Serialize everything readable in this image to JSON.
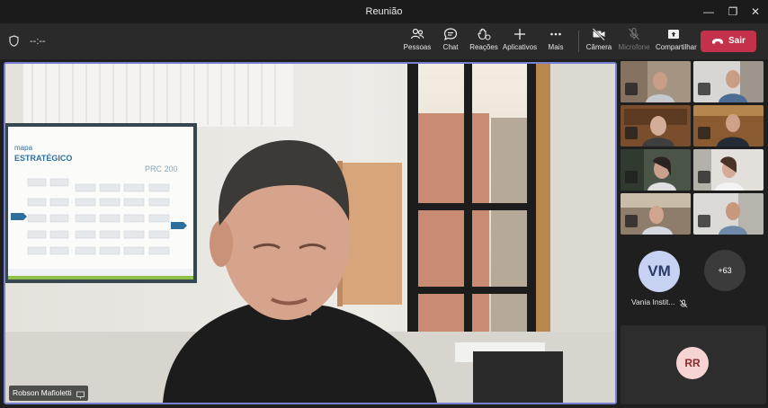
{
  "window": {
    "title": "Reunião"
  },
  "toolbar": {
    "timer": "--:--",
    "people": "Pessoas",
    "chat": "Chat",
    "reactions": "Reações",
    "apps": "Aplicativos",
    "more": "Mais",
    "camera": "Câmera",
    "microphone": "Microfone",
    "share": "Compartilhar",
    "leave": "Sair"
  },
  "stage": {
    "speaker_name": "Robson Mafioletti",
    "board_title_1": "mapa",
    "board_title_2": "ESTRATÉGICO",
    "board_logo": "PRC 200"
  },
  "participants": {
    "vm_initials": "VM",
    "vm_name": "Vania Instit...",
    "more_count": "+63",
    "rr_initials": "RR"
  },
  "colors": {
    "accent": "#7b7fd4",
    "leave": "#c4314b"
  }
}
